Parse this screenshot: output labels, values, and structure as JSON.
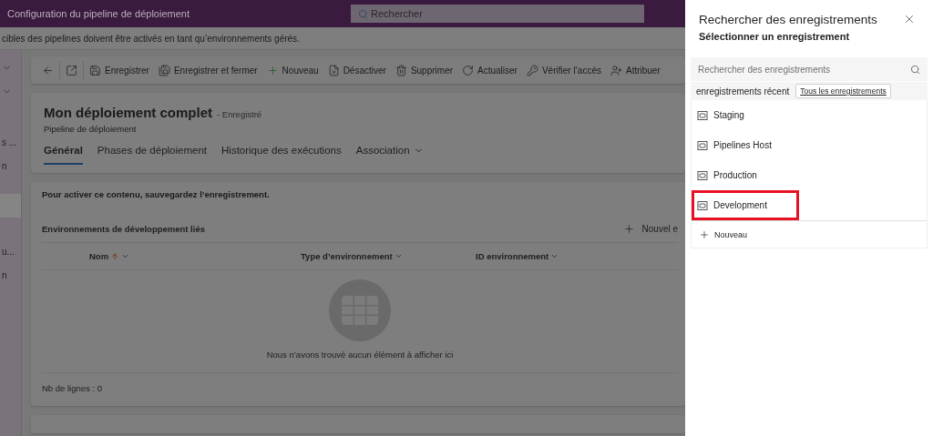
{
  "top_bar": {
    "title": "Configuration du pipeline de déploiement",
    "search_placeholder": "Rechercher"
  },
  "notice": "cibles des pipelines doivent être activés en tant qu’environnements gérés.",
  "left_nav": [
    {
      "kind": "chevron"
    },
    {
      "kind": "chevron"
    },
    {
      "kind": "text",
      "label": "s ..."
    },
    {
      "kind": "text",
      "label": "n"
    },
    {
      "kind": "blank",
      "selected": true
    },
    {
      "kind": "text",
      "label": "u..."
    },
    {
      "kind": "text",
      "label": "n"
    }
  ],
  "toolbar": [
    {
      "kind": "back"
    },
    {
      "kind": "popout"
    },
    {
      "kind": "save",
      "label": "Enregistrer"
    },
    {
      "kind": "save_close",
      "label": "Enregistrer et fermer"
    },
    {
      "kind": "new",
      "label": "Nouveau"
    },
    {
      "kind": "deactivate",
      "label": "Désactiver"
    },
    {
      "kind": "delete",
      "label": "Supprimer"
    },
    {
      "kind": "refresh",
      "label": "Actualiser"
    },
    {
      "kind": "access",
      "label": "Vérifier l’accès"
    },
    {
      "kind": "assign",
      "label": "Attribuer"
    }
  ],
  "record": {
    "title": "Mon déploiement complet",
    "status": "- Enregistré",
    "entity": "Pipeline de déploiement"
  },
  "tabs": [
    {
      "label": "Général",
      "selected": true
    },
    {
      "label": "Phases de déploiement",
      "selected": false
    },
    {
      "label": "Historique des exécutions",
      "selected": false
    },
    {
      "label": "Association",
      "selected": false,
      "dropdown": true
    }
  ],
  "content": {
    "message": "Pour activer ce contenu, sauvegardez l’enregistrement.",
    "section_title": "Environnements de développement liés",
    "new_button": "Nouvel e",
    "columns": [
      {
        "label": "Nom",
        "sorted": true
      },
      {
        "label": "Type d’environnement",
        "sorted": false
      },
      {
        "label": "ID environnement",
        "sorted": false
      }
    ],
    "empty_text": "Nous n’avons trouvé aucun élément à afficher ici",
    "row_count": "Nb de lignes : 0"
  },
  "lookup": {
    "title": "Rechercher des enregistrements",
    "subtitle": "Sélectionner un enregistrement",
    "search_placeholder": "Rechercher des enregistrements",
    "recent_label": "enregistrements récent",
    "all_link": "Tous les enregistrements",
    "items": [
      {
        "label": "Staging",
        "highlighted": false
      },
      {
        "label": "Pipelines Host",
        "highlighted": false
      },
      {
        "label": "Production",
        "highlighted": false
      },
      {
        "label": "Development",
        "highlighted": true
      }
    ],
    "new_label": "Nouveau"
  }
}
